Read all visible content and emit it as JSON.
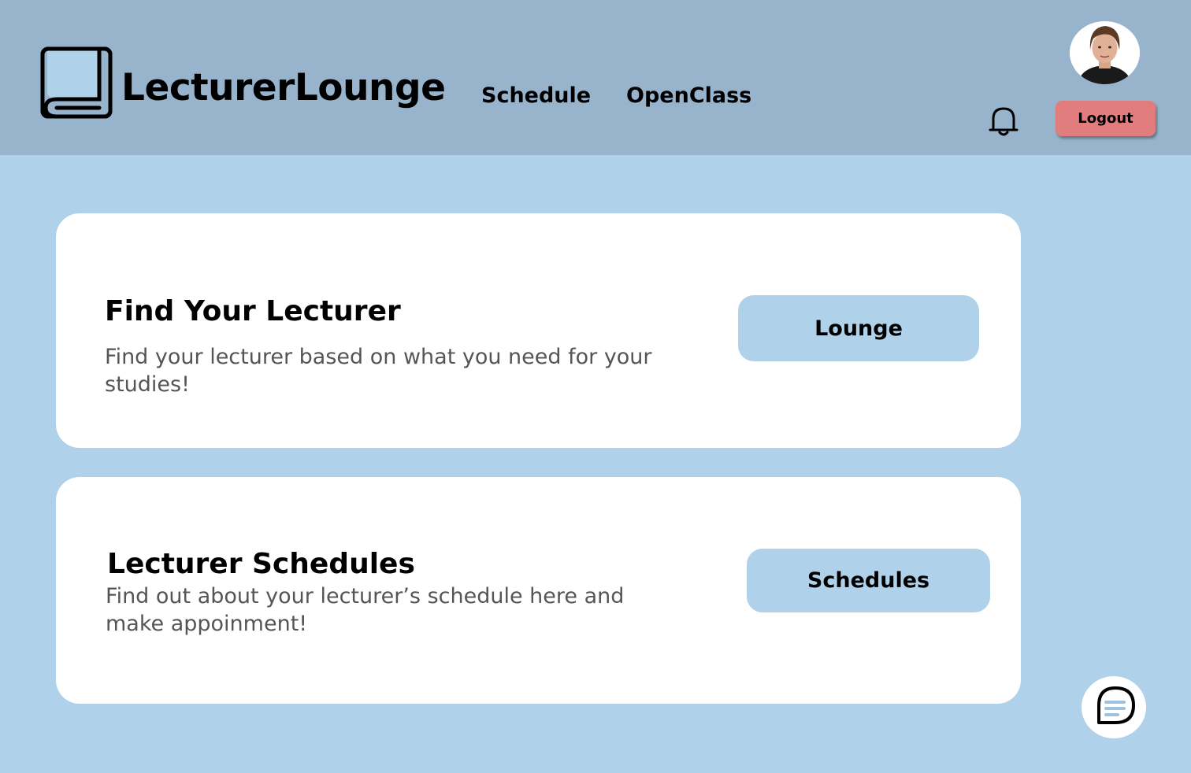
{
  "header": {
    "brand": "LecturerLounge",
    "nav": [
      {
        "label": "Schedule"
      },
      {
        "label": "OpenClass"
      }
    ],
    "logout_label": "Logout",
    "icons": {
      "logo": "book-icon",
      "notifications": "bell-icon",
      "avatar": "user-avatar"
    }
  },
  "cards": [
    {
      "title": "Find Your Lecturer",
      "description": "Find your lecturer based on what you need for your studies!",
      "button_label": "Lounge"
    },
    {
      "title": "Lecturer Schedules",
      "description": "Find out about your lecturer’s schedule here and make appoinment!",
      "button_label": "Schedules"
    }
  ],
  "chat": {
    "icon": "chat-bubble-icon"
  },
  "colors": {
    "header_bg": "#98b3cc",
    "page_bg": "#b0d1ea",
    "card_bg": "#ffffff",
    "logout_bg": "#e27d7d",
    "button_bg": "#b0d1ea"
  }
}
